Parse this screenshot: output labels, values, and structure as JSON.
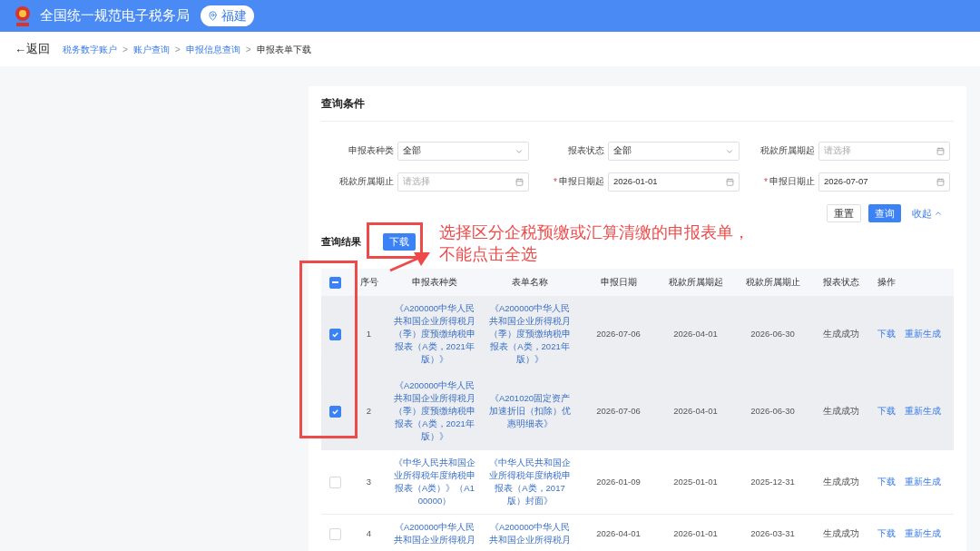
{
  "header": {
    "title": "全国统一规范电子税务局",
    "region": "福建"
  },
  "nav": {
    "back": "←返回",
    "separator": ">",
    "breadcrumb": [
      {
        "label": "税务数字账户",
        "current": false
      },
      {
        "label": "账户查询",
        "current": false
      },
      {
        "label": "申报信息查询",
        "current": false
      },
      {
        "label": "申报表单下载",
        "current": true
      }
    ]
  },
  "query": {
    "title": "查询条件",
    "required_mark": "*",
    "fields": [
      {
        "label": "申报表种类",
        "required": false,
        "kind": "select",
        "value": "全部"
      },
      {
        "label": "报表状态",
        "required": false,
        "kind": "select",
        "value": "全部"
      },
      {
        "label": "税款所属期起",
        "required": false,
        "kind": "date",
        "placeholder": "请选择"
      },
      {
        "label": "税款所属期止",
        "required": false,
        "kind": "date",
        "placeholder": "请选择"
      },
      {
        "label": "申报日期起",
        "required": true,
        "kind": "date",
        "value": "2026-01-01"
      },
      {
        "label": "申报日期止",
        "required": true,
        "kind": "date",
        "value": "2026-07-07"
      }
    ],
    "buttons": {
      "reset": "重置",
      "search": "查询",
      "collapse": "收起"
    }
  },
  "results": {
    "title": "查询结果",
    "download": "下载",
    "select_all_indeterminate": true,
    "columns": [
      "序号",
      "申报表种类",
      "表单名称",
      "申报日期",
      "税款所属期起",
      "税款所属期止",
      "报表状态",
      "操作"
    ],
    "rows": [
      {
        "checked": true,
        "seq": "1",
        "type": "《A200000中华人民共和国企业所得税月（季）度预缴纳税申报表（A类，2021年版）》",
        "form": "《A200000中华人民共和国企业所得税月（季）度预缴纳税申报表（A类，2021年版）》",
        "date": "2026-07-06",
        "start": "2026-04-01",
        "end": "2026-06-30",
        "status": "生成成功",
        "actions": [
          "下载",
          "重新生成"
        ]
      },
      {
        "checked": true,
        "seq": "2",
        "type": "《A200000中华人民共和国企业所得税月（季）度预缴纳税申报表（A类，2021年版）》",
        "form": "《A201020固定资产加速折旧（扣除）优惠明细表》",
        "date": "2026-07-06",
        "start": "2026-04-01",
        "end": "2026-06-30",
        "status": "生成成功",
        "actions": [
          "下载",
          "重新生成"
        ]
      },
      {
        "checked": false,
        "seq": "3",
        "type": "《中华人民共和国企业所得税年度纳税申报表（A类）》（A100000）",
        "form": "《中华人民共和国企业所得税年度纳税申报表（A类，2017版）封面》",
        "date": "2026-01-09",
        "start": "2025-01-01",
        "end": "2025-12-31",
        "status": "生成成功",
        "actions": [
          "下载",
          "重新生成"
        ]
      },
      {
        "checked": false,
        "seq": "4",
        "type": "《A200000中华人民共和国企业所得税月",
        "form": "《A200000中华人民共和国企业所得税月",
        "date": "2026-04-01",
        "start": "2026-01-01",
        "end": "2026-03-31",
        "status": "生成成功",
        "actions": [
          "下载",
          "重新生成"
        ]
      }
    ]
  },
  "annotation": {
    "text": "选择区分企税预缴或汇算清缴的申报表单，不能点击全选"
  }
}
